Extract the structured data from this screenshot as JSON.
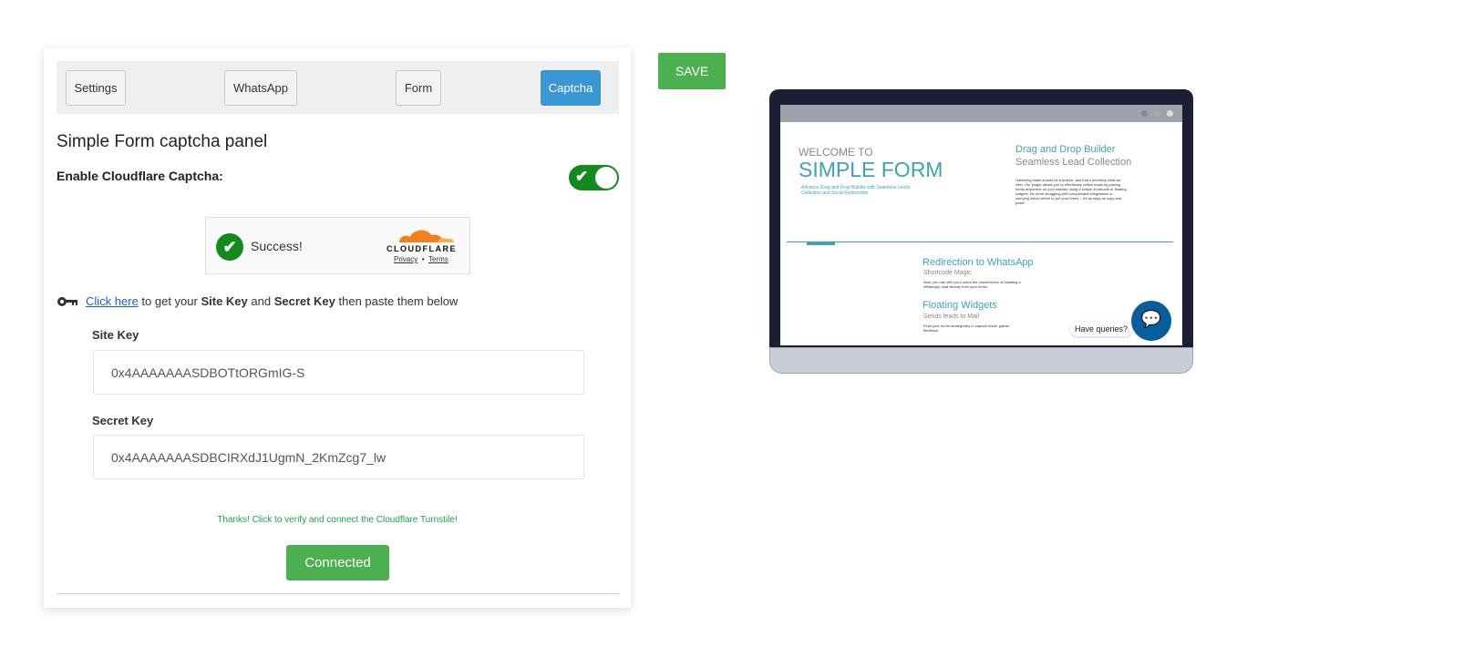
{
  "tabs": [
    {
      "label": "Settings"
    },
    {
      "label": "WhatsApp"
    },
    {
      "label": "Form"
    },
    {
      "label": "Captcha"
    }
  ],
  "panel_title": "Simple Form captcha panel",
  "enable_label": "Enable Cloudflare Captcha:",
  "enable_value": true,
  "turnstile": {
    "status": "Success!",
    "brand": "CLOUDFLARE",
    "privacy": "Privacy",
    "sep": "•",
    "terms": "Terms"
  },
  "hint": {
    "link": "Click here",
    "t1": " to get your ",
    "b1": "Site Key",
    "t2": " and ",
    "b2": "Secret Key",
    "t3": " then paste them below"
  },
  "site_key": {
    "label": "Site Key",
    "value": "0x4AAAAAAASDBOTtORGmIG-S"
  },
  "secret_key": {
    "label": "Secret Key",
    "value": "0x4AAAAAAASDBCIRXdJ1UgmN_2KmZcg7_lw"
  },
  "thanks": "Thanks! Click to verify and connect the Cloudflare Turnstile!",
  "connected_label": "Connected",
  "save_label": "SAVE",
  "preview": {
    "welcome": "WELCOME TO",
    "title": "SIMPLE FORM",
    "subtitle": "Advance Drag and Drop Builder with Seamless Leads Collection and Social Redirection",
    "h1": "Drag and Drop Builder",
    "h1sub": "Seamless Lead Collection",
    "p1": "Gathering leads should be a breeze, and that's precisely what we offer. Our plugin allows you to effortlessly collect leads by placing forms anywhere on your website using a simple shortcode or floating widgets. No more struggling with complicated integrations or worrying about where to put your forms – it's as easy as copy and paste.",
    "h2": "Redirection to WhatsApp",
    "h2sub": "Shortcode Magic",
    "p2": "Now, you can offer your users the convenience of initiating a WhatsApp chat directly from your forms.",
    "h3": "Floating Widgets",
    "h3sub": "Sends leads to Mail",
    "p3": "Float your forms strategically to capture leads, gather feedback,",
    "chat": "Have queries?"
  }
}
